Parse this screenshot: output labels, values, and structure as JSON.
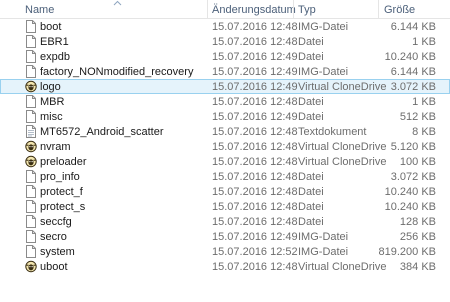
{
  "columns": {
    "name": "Name",
    "date": "Änderungsdatum",
    "type": "Typ",
    "size": "Größe"
  },
  "files": [
    {
      "name": "boot",
      "date": "15.07.2016 12:48",
      "type": "IMG-Datei",
      "size": "6.144 KB",
      "icon": "file-icon",
      "selected": false
    },
    {
      "name": "EBR1",
      "date": "15.07.2016 12:48",
      "type": "Datei",
      "size": "1 KB",
      "icon": "file-icon",
      "selected": false
    },
    {
      "name": "expdb",
      "date": "15.07.2016 12:49",
      "type": "Datei",
      "size": "10.240 KB",
      "icon": "file-icon",
      "selected": false
    },
    {
      "name": "factory_NONmodified_recovery",
      "date": "15.07.2016 12:49",
      "type": "IMG-Datei",
      "size": "6.144 KB",
      "icon": "file-icon",
      "selected": false
    },
    {
      "name": "logo",
      "date": "15.07.2016 12:49",
      "type": "Virtual CloneDrive",
      "size": "3.072 KB",
      "icon": "clonedrive-sheep-icon",
      "selected": true
    },
    {
      "name": "MBR",
      "date": "15.07.2016 12:48",
      "type": "Datei",
      "size": "1 KB",
      "icon": "file-icon",
      "selected": false
    },
    {
      "name": "misc",
      "date": "15.07.2016 12:49",
      "type": "Datei",
      "size": "512 KB",
      "icon": "file-icon",
      "selected": false
    },
    {
      "name": "MT6572_Android_scatter",
      "date": "15.07.2016 12:48",
      "type": "Textdokument",
      "size": "8 KB",
      "icon": "text-document-icon",
      "selected": false
    },
    {
      "name": "nvram",
      "date": "15.07.2016 12:48",
      "type": "Virtual CloneDrive",
      "size": "5.120 KB",
      "icon": "clonedrive-sheep-icon",
      "selected": false
    },
    {
      "name": "preloader",
      "date": "15.07.2016 12:48",
      "type": "Virtual CloneDrive",
      "size": "100 KB",
      "icon": "clonedrive-sheep-icon",
      "selected": false
    },
    {
      "name": "pro_info",
      "date": "15.07.2016 12:48",
      "type": "Datei",
      "size": "3.072 KB",
      "icon": "file-icon",
      "selected": false
    },
    {
      "name": "protect_f",
      "date": "15.07.2016 12:48",
      "type": "Datei",
      "size": "10.240 KB",
      "icon": "file-icon",
      "selected": false
    },
    {
      "name": "protect_s",
      "date": "15.07.2016 12:48",
      "type": "Datei",
      "size": "10.240 KB",
      "icon": "file-icon",
      "selected": false
    },
    {
      "name": "seccfg",
      "date": "15.07.2016 12:48",
      "type": "Datei",
      "size": "128 KB",
      "icon": "file-icon",
      "selected": false
    },
    {
      "name": "secro",
      "date": "15.07.2016 12:49",
      "type": "IMG-Datei",
      "size": "256 KB",
      "icon": "file-icon",
      "selected": false
    },
    {
      "name": "system",
      "date": "15.07.2016 12:52",
      "type": "IMG-Datei",
      "size": "819.200 KB",
      "icon": "file-icon",
      "selected": false
    },
    {
      "name": "uboot",
      "date": "15.07.2016 12:48",
      "type": "Virtual CloneDrive",
      "size": "384 KB",
      "icon": "clonedrive-sheep-icon",
      "selected": false
    }
  ]
}
